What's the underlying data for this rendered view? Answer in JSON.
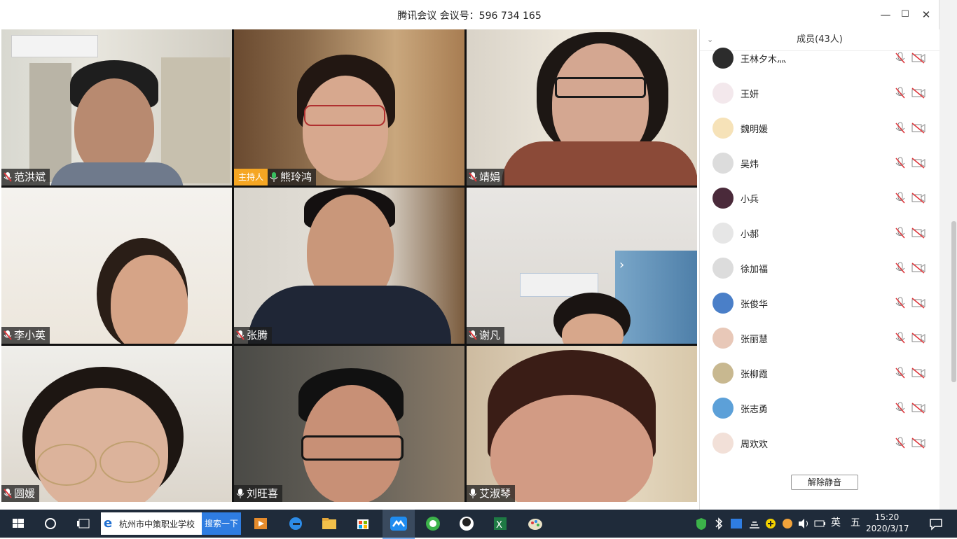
{
  "window": {
    "title": "腾讯会议 会议号：596 734 165",
    "minimize": "—",
    "maximize": "☐",
    "close": "✕"
  },
  "tiles": [
    {
      "name": "范洪斌",
      "mic": "muted"
    },
    {
      "name": "熊玲鸿",
      "mic": "on",
      "host_label": "主持人"
    },
    {
      "name": "靖娟",
      "mic": "muted"
    },
    {
      "name": "李小英",
      "mic": "muted"
    },
    {
      "name": "张腾",
      "mic": "muted"
    },
    {
      "name": "谢凡",
      "mic": "muted"
    },
    {
      "name": "圆媛",
      "mic": "muted"
    },
    {
      "name": "刘旺喜",
      "mic": "on"
    },
    {
      "name": "艾淑琴",
      "mic": "on"
    }
  ],
  "members_panel": {
    "header": "成员(43人)",
    "members": [
      {
        "name": "王林夕木灬"
      },
      {
        "name": "王妍"
      },
      {
        "name": "魏明媛"
      },
      {
        "name": "吴炜"
      },
      {
        "name": "小兵"
      },
      {
        "name": "小郝"
      },
      {
        "name": "徐加福"
      },
      {
        "name": "张俊华"
      },
      {
        "name": "张丽慧"
      },
      {
        "name": "张柳霞"
      },
      {
        "name": "张志勇"
      },
      {
        "name": "周欢欢"
      }
    ],
    "unmute_button": "解除静音"
  },
  "taskbar": {
    "search_text": "杭州市中策职业学校",
    "search_button": "搜索一下",
    "ime": "英",
    "calendar_char": "五",
    "time": "15:20",
    "date": "2020/3/17"
  },
  "colors": {
    "host_badge": "#f5a623",
    "muted_icon": "#e0393e",
    "taskbar": "#1f2b3a",
    "active_border": "#1b5fc8"
  }
}
